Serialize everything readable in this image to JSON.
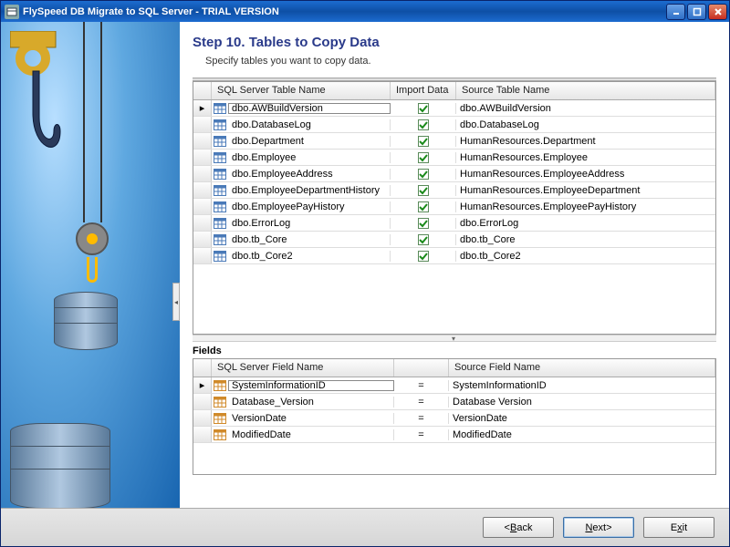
{
  "title": "FlySpeed DB Migrate to SQL Server - TRIAL VERSION",
  "step_heading": "Step 10. Tables to Copy Data",
  "step_sub": "Specify tables you want to copy data.",
  "tables_header": {
    "c1": "SQL Server Table Name",
    "c2": "Import Data",
    "c3": "Source Table Name"
  },
  "tables": [
    {
      "sql": "dbo.AWBuildVersion",
      "import": true,
      "source": "dbo.AWBuildVersion",
      "current": true
    },
    {
      "sql": "dbo.DatabaseLog",
      "import": true,
      "source": "dbo.DatabaseLog"
    },
    {
      "sql": "dbo.Department",
      "import": true,
      "source": "HumanResources.Department"
    },
    {
      "sql": "dbo.Employee",
      "import": true,
      "source": "HumanResources.Employee"
    },
    {
      "sql": "dbo.EmployeeAddress",
      "import": true,
      "source": "HumanResources.EmployeeAddress"
    },
    {
      "sql": "dbo.EmployeeDepartmentHistory",
      "import": true,
      "source": "HumanResources.EmployeeDepartment"
    },
    {
      "sql": "dbo.EmployeePayHistory",
      "import": true,
      "source": "HumanResources.EmployeePayHistory"
    },
    {
      "sql": "dbo.ErrorLog",
      "import": true,
      "source": "dbo.ErrorLog"
    },
    {
      "sql": "dbo.tb_Core",
      "import": true,
      "source": "dbo.tb_Core"
    },
    {
      "sql": "dbo.tb_Core2",
      "import": true,
      "source": "dbo.tb_Core2"
    }
  ],
  "fields_label": "Fields",
  "fields_header": {
    "c1": "SQL Server Field Name",
    "c2": "Source Field Name"
  },
  "fields": [
    {
      "sql": "SystemInformationID",
      "source": "SystemInformationID",
      "current": true
    },
    {
      "sql": "Database_Version",
      "source": "Database Version"
    },
    {
      "sql": "VersionDate",
      "source": "VersionDate"
    },
    {
      "sql": "ModifiedDate",
      "source": "ModifiedDate"
    }
  ],
  "buttons": {
    "back": "Back",
    "next": "Next",
    "exit": "Exit",
    "back_sym": "< ",
    "next_sym": " >"
  }
}
